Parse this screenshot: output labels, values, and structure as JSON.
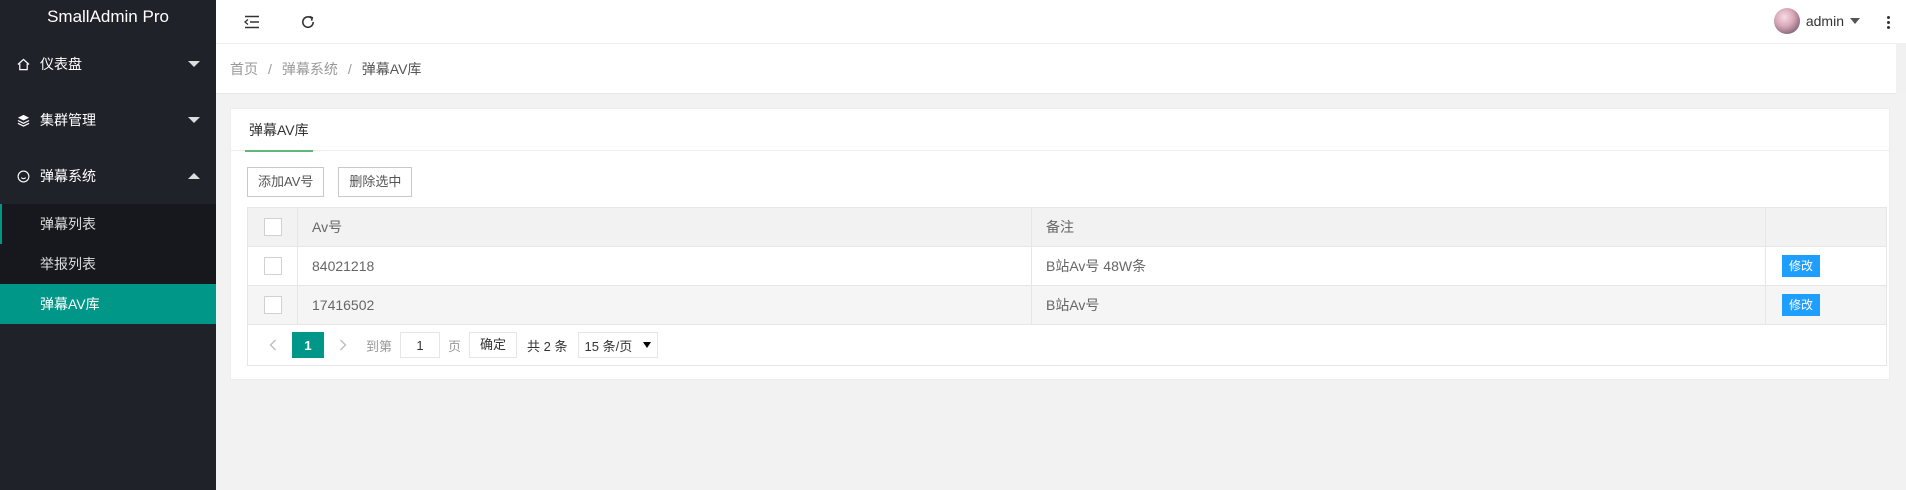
{
  "app": {
    "title": "SmallAdmin Pro"
  },
  "sidebar": {
    "items": [
      {
        "label": "仪表盘",
        "icon": "home-icon",
        "expanded": false
      },
      {
        "label": "集群管理",
        "icon": "layers-icon",
        "expanded": false
      },
      {
        "label": "弹幕系统",
        "icon": "smile-icon",
        "expanded": true,
        "children": [
          {
            "label": "弹幕列表"
          },
          {
            "label": "举报列表"
          },
          {
            "label": "弹幕AV库",
            "active": true
          }
        ]
      }
    ]
  },
  "header": {
    "menu_icon": "menu-fold-icon",
    "refresh_icon": "refresh-icon",
    "user_name": "admin",
    "more_icon": "more-vertical-icon"
  },
  "breadcrumb": {
    "items": [
      "首页",
      "弹幕系统",
      "弹幕AV库"
    ],
    "separator": "/"
  },
  "tab": {
    "label": "弹幕AV库"
  },
  "toolbar": {
    "add_label": "添加AV号",
    "delete_label": "删除选中"
  },
  "table": {
    "columns": [
      "",
      "Av号",
      "备注",
      ""
    ],
    "rows": [
      {
        "av": "84021218",
        "note": "B站Av号 48W条",
        "action": "修改"
      },
      {
        "av": "17416502",
        "note": "B站Av号",
        "action": "修改"
      }
    ]
  },
  "pager": {
    "prev": "<",
    "current_page": "1",
    "next": ">",
    "goto_label": "到第",
    "goto_value": "1",
    "page_label": "页",
    "confirm_label": "确定",
    "total_text": "共 2 条",
    "page_size": "15 条/页"
  },
  "colors": {
    "sidebar_bg": "#20222a",
    "accent": "#009688",
    "primary_button": "#1E9FFF",
    "tab_underline": "#5FB878"
  }
}
